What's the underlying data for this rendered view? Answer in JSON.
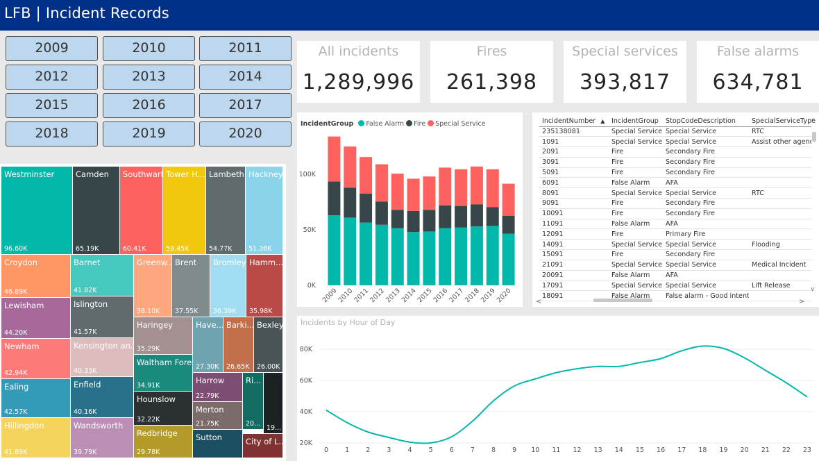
{
  "header": {
    "brand": "LFB",
    "separator": " | ",
    "title": "Incident Records"
  },
  "years": [
    "2009",
    "2010",
    "2011",
    "2012",
    "2013",
    "2014",
    "2015",
    "2016",
    "2017",
    "2018",
    "2019",
    "2020"
  ],
  "cards": [
    {
      "label": "All incidents",
      "value": "1,289,996"
    },
    {
      "label": "Fires",
      "value": "261,398"
    },
    {
      "label": "Special services",
      "value": "393,817"
    },
    {
      "label": "False alarms",
      "value": "634,781"
    }
  ],
  "treemap": [
    {
      "name": "Westminster",
      "value": "96.60K",
      "color": "#01b8aa"
    },
    {
      "name": "Camden",
      "value": "65.19K",
      "color": "#374649"
    },
    {
      "name": "Southwark",
      "value": "60.41K",
      "color": "#fd625e"
    },
    {
      "name": "Tower H...",
      "value": "59.45K",
      "color": "#f2c80f"
    },
    {
      "name": "Lambeth",
      "value": "54.77K",
      "color": "#5f6b6d"
    },
    {
      "name": "Hackney",
      "value": "51.38K",
      "color": "#8ad4eb"
    },
    {
      "name": "Croydon",
      "value": "46.89K",
      "color": "#fe9666"
    },
    {
      "name": "Barnet",
      "value": "41.82K",
      "color": "#47c8bd"
    },
    {
      "name": "Greenw...",
      "value": "38.10K",
      "color": "#fea67d"
    },
    {
      "name": "Brent",
      "value": "37.55K",
      "color": "#7f8a8c"
    },
    {
      "name": "Bromley",
      "value": "36.39K",
      "color": "#a2dcf0"
    },
    {
      "name": "Hamm...",
      "value": "35.98K",
      "color": "#b94a47"
    },
    {
      "name": "Lewisham",
      "value": "44.20K",
      "color": "#a66999"
    },
    {
      "name": "Islington",
      "value": "41.57K",
      "color": "#5f6b6d"
    },
    {
      "name": "Newham",
      "value": "42.94K",
      "color": "#fb7a78"
    },
    {
      "name": "Kensington an...",
      "value": "40.33K",
      "color": "#ddbcbe"
    },
    {
      "name": "Haringey",
      "value": "35.29K",
      "color": "#a49090"
    },
    {
      "name": "Have...",
      "value": "27.30K",
      "color": "#6da4b0"
    },
    {
      "name": "Barki...",
      "value": "26.65K",
      "color": "#c2704b"
    },
    {
      "name": "Bexley",
      "value": "26.00K",
      "color": "#4a5456"
    },
    {
      "name": "Ealing",
      "value": "42.57K",
      "color": "#3599b8"
    },
    {
      "name": "Enfield",
      "value": "40.16K",
      "color": "#27718a"
    },
    {
      "name": "Waltham Forest",
      "value": "34.91K",
      "color": "#1b8a7e"
    },
    {
      "name": "Hillingdon",
      "value": "41.89K",
      "color": "#f5d35f"
    },
    {
      "name": "Wandsworth",
      "value": "39.79K",
      "color": "#ba8eb5"
    },
    {
      "name": "Hounslow",
      "value": "32.22K",
      "color": "#2b3133"
    },
    {
      "name": "Harrow",
      "value": "22.79K",
      "color": "#7d4c73"
    },
    {
      "name": "Merton",
      "value": "21.75K",
      "color": "#7b6b6b"
    },
    {
      "name": "Ri...",
      "value": "20...",
      "color": "#136b62"
    },
    {
      "name": "",
      "value": "19...",
      "color": "#1c2223"
    },
    {
      "name": "Redbridge",
      "value": "29.78K",
      "color": "#b49a29"
    },
    {
      "name": "Sutton",
      "value": "",
      "color": "#1b4e60"
    },
    {
      "name": "City of L...",
      "value": "",
      "color": "#7e3231"
    }
  ],
  "bar_legend": {
    "title": "IncidentGroup",
    "items": [
      {
        "name": "False Alarm",
        "color": "#01b8aa"
      },
      {
        "name": "Fire",
        "color": "#374649"
      },
      {
        "name": "Special Service",
        "color": "#fd625e"
      }
    ]
  },
  "table": {
    "columns": [
      "IncidentNumber",
      "IncidentGroup",
      "StopCodeDescription",
      "SpecialServiceType"
    ],
    "rows": [
      [
        "235138081",
        "Special Service",
        "Special Service",
        "RTC"
      ],
      [
        "1091",
        "Special Service",
        "Special Service",
        "Assist other agencies"
      ],
      [
        "2091",
        "Fire",
        "Secondary Fire",
        ""
      ],
      [
        "3091",
        "Fire",
        "Secondary Fire",
        ""
      ],
      [
        "5091",
        "Fire",
        "Secondary Fire",
        ""
      ],
      [
        "6091",
        "False Alarm",
        "AFA",
        ""
      ],
      [
        "8091",
        "Special Service",
        "Special Service",
        "RTC"
      ],
      [
        "9091",
        "Fire",
        "Secondary Fire",
        ""
      ],
      [
        "10091",
        "Fire",
        "Secondary Fire",
        ""
      ],
      [
        "11091",
        "False Alarm",
        "AFA",
        ""
      ],
      [
        "12091",
        "Fire",
        "Primary Fire",
        ""
      ],
      [
        "14091",
        "Special Service",
        "Special Service",
        "Flooding"
      ],
      [
        "15091",
        "Fire",
        "Secondary Fire",
        ""
      ],
      [
        "21091",
        "Special Service",
        "Special Service",
        "Medical Incident"
      ],
      [
        "20091",
        "False Alarm",
        "AFA",
        ""
      ],
      [
        "17091",
        "Special Service",
        "Special Service",
        "Lift Release"
      ],
      [
        "18091",
        "False Alarm",
        "False alarm - Good intent",
        ""
      ]
    ]
  },
  "chart_data": [
    {
      "type": "bar",
      "title": "",
      "categories": [
        "2009",
        "2010",
        "2011",
        "2012",
        "2013",
        "2014",
        "2015",
        "2016",
        "2017",
        "2018",
        "2019",
        "2020"
      ],
      "ylim": [
        0,
        140000
      ],
      "yticks": [
        0,
        50000,
        100000
      ],
      "ytick_labels": [
        "0K",
        "50K",
        "100K"
      ],
      "series": [
        {
          "name": "False Alarm",
          "values": [
            63000,
            61000,
            56500,
            54500,
            51500,
            48000,
            48500,
            51500,
            52000,
            53000,
            53500,
            46500
          ]
        },
        {
          "name": "Fire",
          "values": [
            30500,
            27000,
            26000,
            21000,
            16500,
            19000,
            19500,
            20500,
            19500,
            20000,
            17000,
            16000
          ]
        },
        {
          "name": "Special Service",
          "values": [
            40500,
            37000,
            33000,
            33500,
            32500,
            29000,
            30000,
            34000,
            33000,
            34000,
            34000,
            29000
          ]
        }
      ]
    },
    {
      "type": "line",
      "title": "Incidents by Hour of Day",
      "x": [
        0,
        1,
        2,
        3,
        4,
        5,
        6,
        7,
        8,
        9,
        10,
        11,
        12,
        13,
        14,
        15,
        16,
        17,
        18,
        19,
        20,
        21,
        22,
        23
      ],
      "ylim": [
        18000,
        86000
      ],
      "yticks": [
        20000,
        40000,
        60000,
        80000
      ],
      "ytick_labels": [
        "20K",
        "40K",
        "60K",
        "80K"
      ],
      "series": [
        {
          "values": [
            41000,
            33000,
            27000,
            23500,
            20500,
            20000,
            24000,
            34000,
            47000,
            56500,
            61000,
            65000,
            67500,
            69000,
            69000,
            71500,
            74000,
            79000,
            82000,
            80500,
            74500,
            66500,
            58500,
            49500
          ]
        }
      ]
    }
  ]
}
